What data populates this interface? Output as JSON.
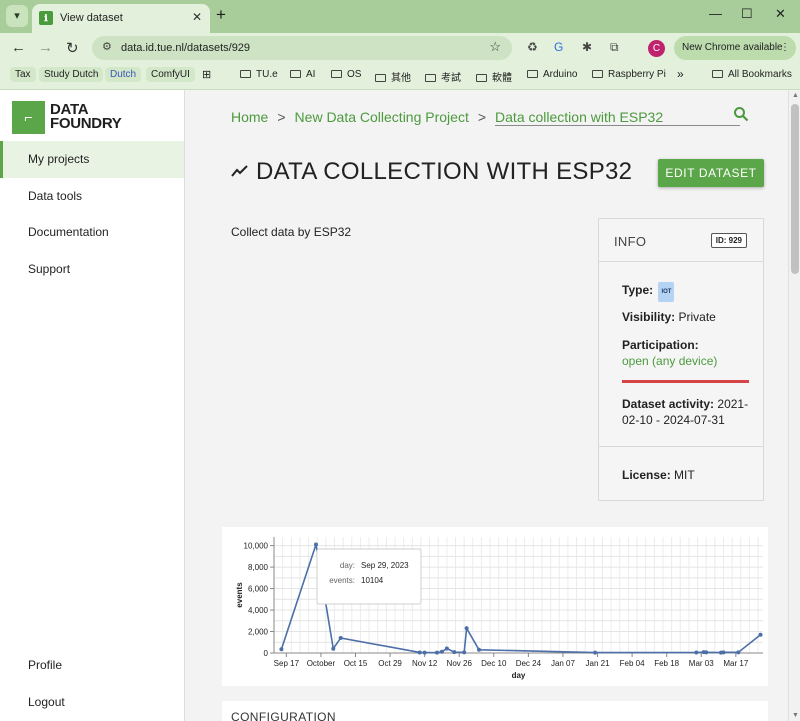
{
  "browser": {
    "tab_title": "View dataset",
    "url": "data.id.tue.nl/datasets/929",
    "update_button": "New Chrome available",
    "profile_initial": "C",
    "bookmarks": [
      "Tax",
      "Study Dutch",
      "Dutch",
      "ComfyUI",
      "TU.e",
      "AI",
      "OS",
      "其他",
      "考試",
      "軟體",
      "Arduino",
      "Raspberry Pi",
      "All Bookmarks"
    ]
  },
  "sidebar": {
    "logo_line1": "DATA",
    "logo_line2": "FOUNDRY",
    "items": [
      {
        "label": "My projects"
      },
      {
        "label": "Data tools"
      },
      {
        "label": "Documentation"
      },
      {
        "label": "Support"
      },
      {
        "label": "Profile"
      },
      {
        "label": "Logout"
      }
    ]
  },
  "breadcrumb": {
    "items": [
      "Home",
      "New Data Collecting Project",
      "Data collection with ESP32"
    ],
    "separator": ">"
  },
  "page": {
    "title": "DATA COLLECTION WITH ESP32",
    "edit_button": "EDIT DATASET",
    "description": "Collect data by ESP32"
  },
  "info": {
    "title": "INFO",
    "id_badge": "ID: 929",
    "type_label": "Type:",
    "type_value": "IOT",
    "visibility_label": "Visibility:",
    "visibility_value": "Private",
    "participation_label": "Participation:",
    "participation_value": "open (any device)",
    "activity_label": "Dataset activity:",
    "activity_value": "2021-02-10 - 2024-07-31",
    "license_label": "License:",
    "license_value": "MIT"
  },
  "config": {
    "title": "CONFIGURATION"
  },
  "colors": {
    "accent": "#5aa649",
    "line": "#4c6fa8",
    "status_bar": "#d64545"
  },
  "chart_data": {
    "type": "line",
    "xlabel": "day",
    "ylabel": "events",
    "ylim": [
      0,
      10800
    ],
    "yticks": [
      0,
      2000,
      4000,
      6000,
      8000,
      10000
    ],
    "ytick_labels": [
      "0",
      "2,000",
      "4,000",
      "6,000",
      "8,000",
      "10,000"
    ],
    "xlim": [
      "2023-09-12",
      "2024-03-28"
    ],
    "xticks": [
      "2023-09-17",
      "2023-10-01",
      "2023-10-15",
      "2023-10-29",
      "2023-11-12",
      "2023-11-26",
      "2023-12-10",
      "2023-12-24",
      "2024-01-07",
      "2024-01-21",
      "2024-02-04",
      "2024-02-18",
      "2024-03-03",
      "2024-03-17"
    ],
    "xtick_labels": [
      "Sep 17",
      "October",
      "Oct 15",
      "Oct 29",
      "Nov 12",
      "Nov 26",
      "Dec 10",
      "Dec 24",
      "Jan 07",
      "Jan 21",
      "Feb 04",
      "Feb 18",
      "Mar 03",
      "Mar 17"
    ],
    "grid": true,
    "points": [
      {
        "x": "2023-09-15",
        "y": 350
      },
      {
        "x": "2023-09-29",
        "y": 10104
      },
      {
        "x": "2023-10-06",
        "y": 400
      },
      {
        "x": "2023-10-09",
        "y": 1400
      },
      {
        "x": "2023-11-10",
        "y": 50
      },
      {
        "x": "2023-11-12",
        "y": 40
      },
      {
        "x": "2023-11-17",
        "y": 30
      },
      {
        "x": "2023-11-19",
        "y": 120
      },
      {
        "x": "2023-11-21",
        "y": 420
      },
      {
        "x": "2023-11-24",
        "y": 80
      },
      {
        "x": "2023-11-28",
        "y": 60
      },
      {
        "x": "2023-11-29",
        "y": 2300
      },
      {
        "x": "2023-12-04",
        "y": 300
      },
      {
        "x": "2024-01-20",
        "y": 40
      },
      {
        "x": "2024-03-01",
        "y": 50
      },
      {
        "x": "2024-03-04",
        "y": 80
      },
      {
        "x": "2024-03-05",
        "y": 60
      },
      {
        "x": "2024-03-11",
        "y": 40
      },
      {
        "x": "2024-03-12",
        "y": 60
      },
      {
        "x": "2024-03-18",
        "y": 60
      },
      {
        "x": "2024-03-27",
        "y": 1700
      }
    ],
    "tooltip": {
      "day_label": "day:",
      "day_value": "Sep 29, 2023",
      "events_label": "events:",
      "events_value": "10104"
    }
  }
}
